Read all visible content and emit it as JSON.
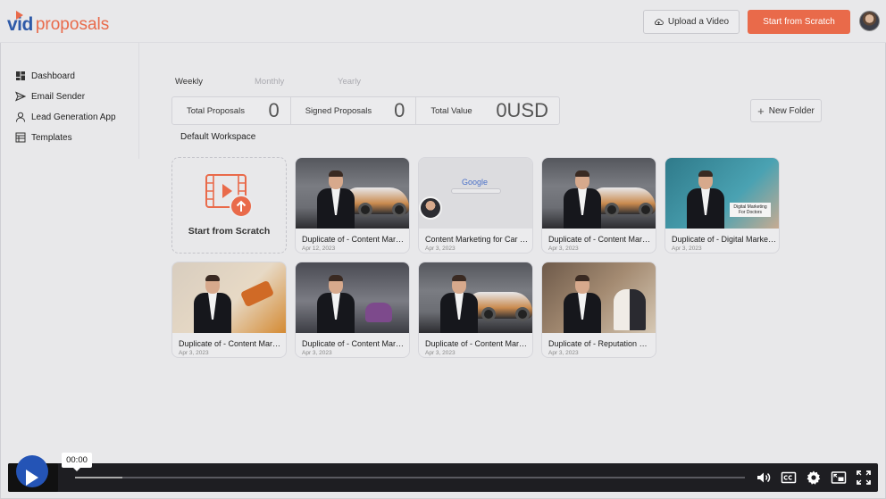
{
  "header": {
    "logo_vid": "vid",
    "logo_proposals": "proposals",
    "upload_label": "Upload a Video",
    "scratch_label": "Start from Scratch"
  },
  "sidebar": {
    "items": [
      {
        "label": "Dashboard",
        "icon": "dashboard-icon"
      },
      {
        "label": "Email Sender",
        "icon": "send-icon"
      },
      {
        "label": "Lead Generation App",
        "icon": "user-icon"
      },
      {
        "label": "Templates",
        "icon": "template-icon"
      }
    ]
  },
  "tabs": [
    {
      "label": "Weekly",
      "active": true
    },
    {
      "label": "Monthly",
      "active": false
    },
    {
      "label": "Yearly",
      "active": false
    }
  ],
  "stats": [
    {
      "label": "Total Proposals",
      "value": "0"
    },
    {
      "label": "Signed Proposals",
      "value": "0"
    },
    {
      "label": "Total Value",
      "value": "0USD"
    }
  ],
  "new_folder_label": "New Folder",
  "workspace_title": "Default Workspace",
  "scratch_card_label": "Start from Scratch",
  "cards": [
    {
      "title": "Duplicate of - Content Marketing for Car Dealerships",
      "date": "Apr 12, 2023",
      "thumb": "car"
    },
    {
      "title": "Content Marketing for Car Dealerships",
      "date": "Apr 3, 2023",
      "thumb": "google"
    },
    {
      "title": "Duplicate of - Content Marketing for Car Dealerships",
      "date": "Apr 3, 2023",
      "thumb": "car"
    },
    {
      "title": "Duplicate of - Digital Marketing For Doctors",
      "date": "Apr 3, 2023",
      "thumb": "doctor"
    },
    {
      "title": "Duplicate of - Content Marketing for Contractors",
      "date": "Apr 3, 2023",
      "thumb": "tools"
    },
    {
      "title": "Duplicate of - Content Marketing for Cleaning",
      "date": "Apr 3, 2023",
      "thumb": "vac"
    },
    {
      "title": "Duplicate of - Content Marketing for Car Dealerships",
      "date": "Apr 3, 2023",
      "thumb": "car"
    },
    {
      "title": "Duplicate of - Reputation Management for Weddings",
      "date": "Apr 3, 2023",
      "thumb": "wed"
    }
  ],
  "thumb_text": {
    "google": "Google",
    "doctor": "Digital Marketing For Doctors"
  },
  "player": {
    "time": "00:00",
    "progress_fraction": 0.07,
    "accent": "#2454b6"
  },
  "colors": {
    "brand_blue": "#2e5aa8",
    "brand_orange": "#e96a4a"
  }
}
